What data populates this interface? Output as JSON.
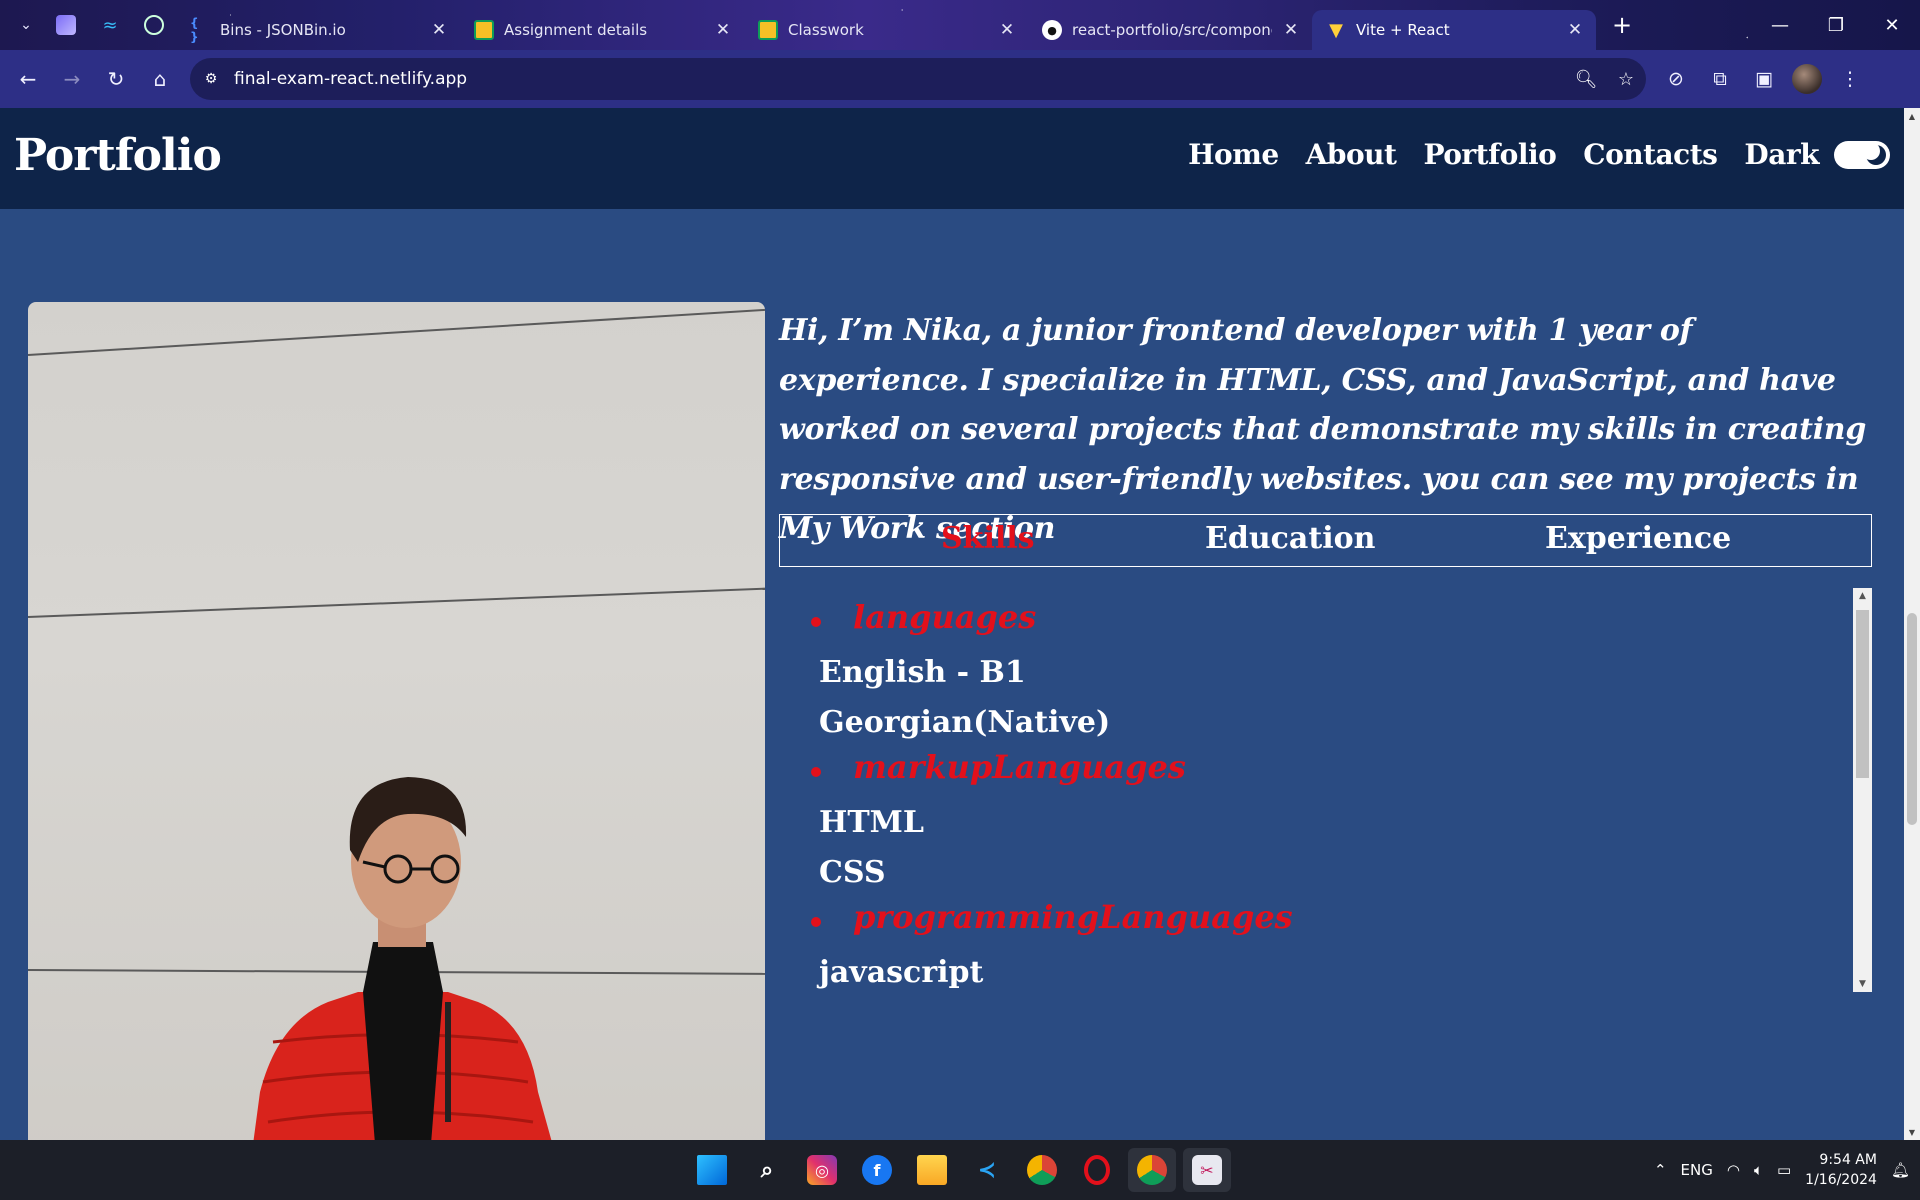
{
  "browser": {
    "tabs": [
      {
        "title": "Bins - JSONBin.io",
        "icon": "braces-icon"
      },
      {
        "title": "Assignment details",
        "icon": "classroom-icon"
      },
      {
        "title": "Classwork",
        "icon": "classroom-icon"
      },
      {
        "title": "react-portfolio/src/componen",
        "icon": "github-icon"
      },
      {
        "title": "Vite + React",
        "icon": "vite-icon"
      }
    ],
    "url": "final-exam-react.netlify.app"
  },
  "site": {
    "logo": "Portfolio",
    "nav": [
      "Home",
      "About",
      "Portfolio",
      "Contacts",
      "Dark"
    ],
    "bio": "Hi, I’m Nika, a junior frontend developer with 1 year of experience. I specialize in HTML, CSS, and JavaScript, and have worked on several projects that demonstrate my skills in creating responsive and user-friendly websites. you can see my projects in My Work section",
    "tabs": [
      "Skills",
      "Education",
      "Experience"
    ],
    "active_tab": "Skills",
    "skills": [
      {
        "category": "languages",
        "items": [
          "English - B1",
          "Georgian(Native)"
        ]
      },
      {
        "category": "markupLanguages",
        "items": [
          "HTML",
          "CSS"
        ]
      },
      {
        "category": "programmingLanguages",
        "items": [
          "javascript"
        ]
      }
    ],
    "colors": {
      "navbar": "#0e2449",
      "background": "#2a4b82",
      "accent": "#e3101b"
    }
  },
  "taskbar": {
    "lang": "ENG",
    "time": "9:54 AM",
    "date": "1/16/2024"
  }
}
